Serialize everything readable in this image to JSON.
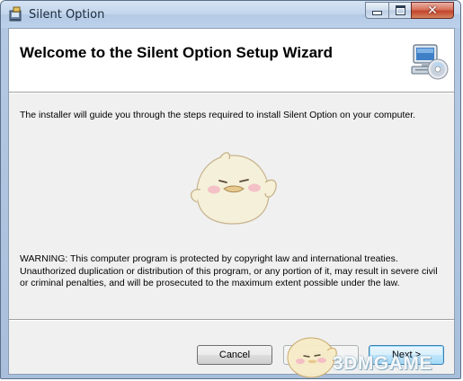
{
  "window": {
    "title": "Silent Option",
    "close_glyph": "✕"
  },
  "banner": {
    "title": "Welcome to the Silent Option Setup Wizard",
    "icon": "computer-cd-icon"
  },
  "body": {
    "intro": "The installer will guide you through the steps required to install Silent Option on your computer.",
    "warning": "WARNING: This computer program is protected by copyright law and international treaties.\nUnauthorized duplication or distribution of this program, or any portion of it, may result in severe civil\nor criminal penalties, and will be prosecuted to the maximum extent possible under the law."
  },
  "buttons": {
    "cancel": "Cancel",
    "back": "< Back",
    "next": "Next >"
  },
  "watermark": {
    "text": "3DMGAME"
  },
  "colors": {
    "titlebar": "#c2d5ec",
    "client_bg": "#f0f0f0",
    "close_button": "#c2452c",
    "next_button": "#bee6fd"
  }
}
